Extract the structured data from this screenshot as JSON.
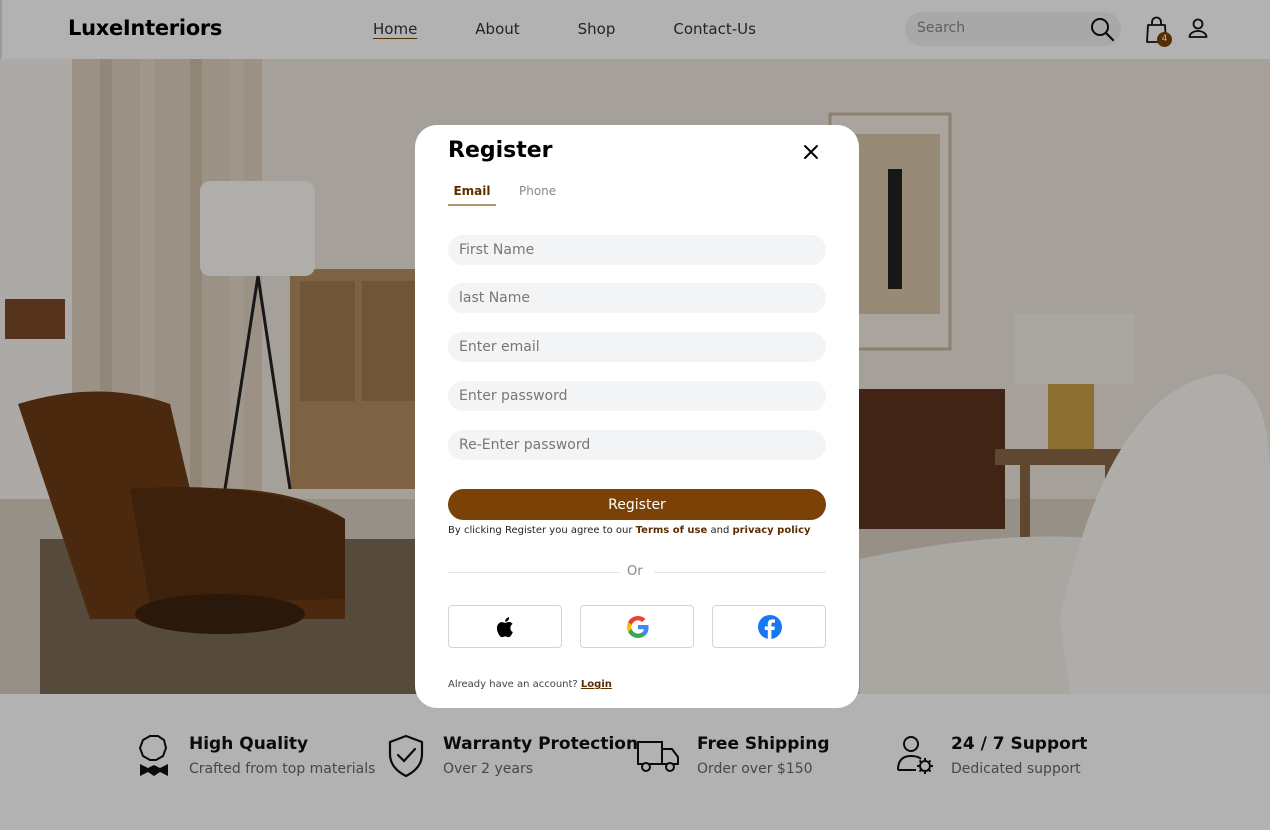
{
  "header": {
    "logo": "LuxeInteriors",
    "nav": [
      "Home",
      "About",
      "Shop",
      "Contact-Us"
    ],
    "active_nav": "Home",
    "search_placeholder": "Search",
    "cart_count": "4"
  },
  "features": [
    {
      "title": "High Quality",
      "subtitle": "Crafted from top materials",
      "icon": "award-ribbon-icon"
    },
    {
      "title": "Warranty Protection",
      "subtitle": "Over 2 years",
      "icon": "shield-check-icon"
    },
    {
      "title": "Free Shipping",
      "subtitle": "Order over $150",
      "icon": "truck-icon"
    },
    {
      "title": "24 / 7 Support",
      "subtitle": "Dedicated support",
      "icon": "user-gear-icon"
    }
  ],
  "modal": {
    "title": "Register",
    "tabs": [
      "Email",
      "Phone"
    ],
    "active_tab": "Email",
    "fields": {
      "first_name": "First Name",
      "last_name": "last Name",
      "email": "Enter email",
      "password": "Enter password",
      "confirm_password": "Re-Enter password"
    },
    "register_label": "Register",
    "terms_prefix": "By clicking Register you agree to our ",
    "terms_link": "Terms of use",
    "terms_and": " and ",
    "privacy_link": "privacy policy",
    "or_label": "Or",
    "social": [
      "apple-icon",
      "google-icon",
      "facebook-icon"
    ],
    "account_prompt": "Already have an account? ",
    "login_link": "Login"
  },
  "colors": {
    "accent": "#7a4206",
    "overlay": "rgba(0,0,0,0.3)"
  }
}
